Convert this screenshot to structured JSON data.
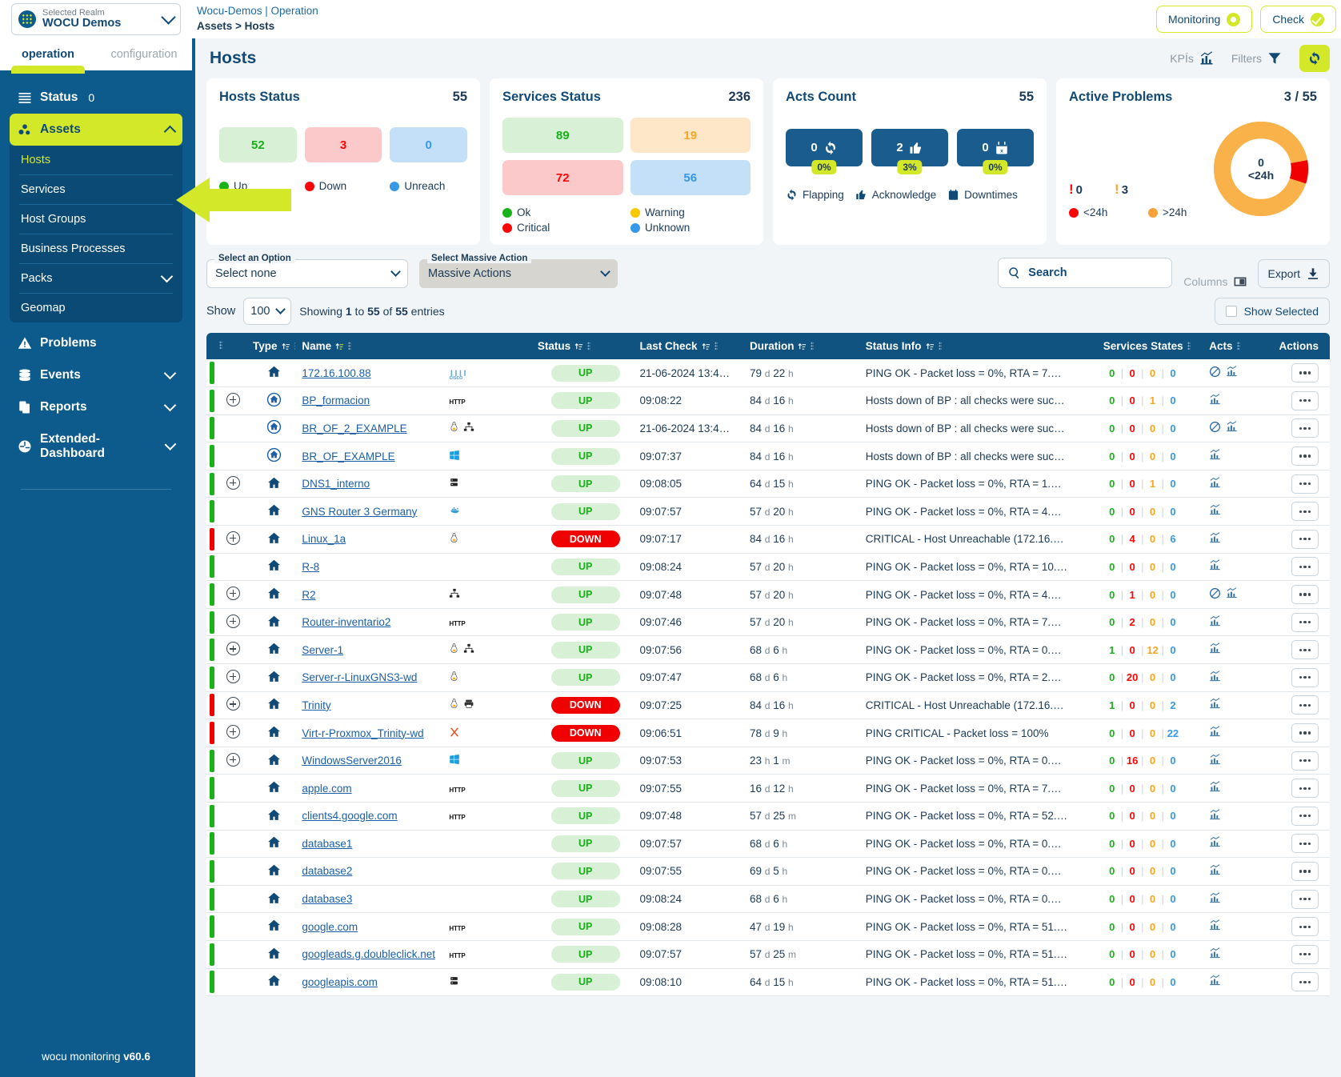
{
  "realm": {
    "label": "Selected Realm",
    "name": "WOCU Demos"
  },
  "breadcrumb": {
    "line1": "Wocu-Demos | Operation",
    "line2": "Assets > Hosts"
  },
  "header_buttons": {
    "monitoring": "Monitoring",
    "check": "Check"
  },
  "tabs": {
    "operation": "operation",
    "configuration": "configuration"
  },
  "sidebar": {
    "status": {
      "label": "Status",
      "count": "0"
    },
    "assets": {
      "label": "Assets"
    },
    "assets_sub": [
      {
        "label": "Hosts",
        "selected": true
      },
      {
        "label": "Services",
        "selected": false
      },
      {
        "label": "Host Groups",
        "selected": false
      },
      {
        "label": "Business Processes",
        "selected": false
      },
      {
        "label": "Packs",
        "selected": false,
        "expandable": true
      },
      {
        "label": "Geomap",
        "selected": false
      }
    ],
    "items": [
      {
        "label": "Problems",
        "expandable": false
      },
      {
        "label": "Events",
        "expandable": true
      },
      {
        "label": "Reports",
        "expandable": true
      },
      {
        "label": "Extended-Dashboard",
        "expandable": true
      }
    ],
    "footer": {
      "text": "wocu monitoring",
      "version": "v60.6"
    }
  },
  "page": {
    "title": "Hosts",
    "kpis_label": "KPÍs",
    "filters_label": "Filters"
  },
  "cards": {
    "hosts_status": {
      "title": "Hosts Status",
      "total": "55",
      "boxes": [
        {
          "value": "52",
          "tone": "green"
        },
        {
          "value": "3",
          "tone": "red"
        },
        {
          "value": "0",
          "tone": "blue"
        }
      ],
      "legend": [
        {
          "label": "Up",
          "tone": "g"
        },
        {
          "label": "Down",
          "tone": "r"
        },
        {
          "label": "Unreach",
          "tone": "b"
        }
      ]
    },
    "services_status": {
      "title": "Services Status",
      "total": "236",
      "boxes": [
        {
          "value": "89",
          "tone": "green"
        },
        {
          "value": "19",
          "tone": "orange"
        },
        {
          "value": "72",
          "tone": "red"
        },
        {
          "value": "56",
          "tone": "blue"
        }
      ],
      "legend": [
        {
          "label": "Ok",
          "tone": "g"
        },
        {
          "label": "Warning",
          "tone": "y"
        },
        {
          "label": "Critical",
          "tone": "r"
        },
        {
          "label": "Unknown",
          "tone": "b"
        }
      ]
    },
    "acts_count": {
      "title": "Acts Count",
      "total": "55",
      "boxes": [
        {
          "value": "0",
          "pct": "0%",
          "icon": "flapping-icon"
        },
        {
          "value": "2",
          "pct": "3%",
          "icon": "thumbs-up-icon"
        },
        {
          "value": "0",
          "pct": "0%",
          "icon": "calendar-icon"
        }
      ],
      "legend": [
        {
          "label": "Flapping",
          "icon": "flapping-icon"
        },
        {
          "label": "Acknowledge",
          "icon": "thumbs-up-icon"
        },
        {
          "label": "Downtimes",
          "icon": "calendar-icon"
        }
      ]
    },
    "active_problems": {
      "title": "Active Problems",
      "total": "3 / 55",
      "counts": [
        {
          "value": "0",
          "tone": "r"
        },
        {
          "value": "3",
          "tone": "o"
        }
      ],
      "legend": [
        {
          "label": "<24h",
          "tone": "r"
        },
        {
          "label": ">24h",
          "tone": "o"
        }
      ],
      "donut": {
        "center_value": "0",
        "center_label": "<24h",
        "red_pct": 8,
        "orange_pct": 92
      }
    }
  },
  "controls": {
    "select_option": {
      "label": "Select an Option",
      "value": "Select none"
    },
    "massive_action": {
      "label": "Select Massive Action",
      "value": "Massive Actions"
    },
    "search_placeholder": "Search",
    "columns_label": "Columns",
    "export_label": "Export",
    "show_label": "Show",
    "show_value": "100",
    "showing_text_pre": "Showing ",
    "showing_from": "1",
    "showing_mid": " to ",
    "showing_to": "55",
    "showing_of": " of ",
    "showing_total": "55",
    "showing_post": " entries",
    "show_selected_label": "Show Selected"
  },
  "table": {
    "columns": [
      "Type",
      "Name",
      "Status",
      "Last Check",
      "Duration",
      "Status Info",
      "Services States",
      "Acts",
      "Actions"
    ],
    "rows": [
      {
        "expand": false,
        "type_icon": "home-icon",
        "name": "172.16.100.88",
        "tech": [
          "cisco"
        ],
        "status": "UP",
        "last_check": "21-06-2024 13:4…",
        "dur_n": "79",
        "dur_u1": "d",
        "dur_n2": "22",
        "dur_u2": "h",
        "info": "PING OK - Packet loss = 0%, RTA = 7.…",
        "svc": [
          "0",
          "0",
          "0",
          "0"
        ],
        "acts": [
          "no-entry-icon",
          "chart-icon"
        ]
      },
      {
        "expand": true,
        "type_icon": "bp-icon",
        "name": "BP_formacion",
        "tech": [
          "http"
        ],
        "status": "UP",
        "last_check": "09:08:22",
        "dur_n": "84",
        "dur_u1": "d",
        "dur_n2": "16",
        "dur_u2": "h",
        "info": "Hosts down of BP : all checks were suc…",
        "svc": [
          "0",
          "0",
          "1",
          "0"
        ],
        "acts": [
          "chart-icon"
        ]
      },
      {
        "expand": false,
        "type_icon": "bp-icon",
        "name": "BR_OF_2_EXAMPLE",
        "tech": [
          "linux",
          "network"
        ],
        "status": "UP",
        "last_check": "21-06-2024 13:4…",
        "dur_n": "84",
        "dur_u1": "d",
        "dur_n2": "16",
        "dur_u2": "h",
        "info": "Hosts down of BP : all checks were suc…",
        "svc": [
          "0",
          "0",
          "0",
          "0"
        ],
        "acts": [
          "no-entry-icon",
          "chart-icon"
        ]
      },
      {
        "expand": false,
        "type_icon": "bp-icon",
        "name": "BR_OF_EXAMPLE",
        "tech": [
          "windows"
        ],
        "status": "UP",
        "last_check": "09:07:37",
        "dur_n": "84",
        "dur_u1": "d",
        "dur_n2": "16",
        "dur_u2": "h",
        "info": "Hosts down of BP : all checks were suc…",
        "svc": [
          "0",
          "0",
          "0",
          "0"
        ],
        "acts": [
          "chart-icon"
        ]
      },
      {
        "expand": true,
        "type_icon": "home-icon",
        "name": "DNS1_interno",
        "tech": [
          "server"
        ],
        "status": "UP",
        "last_check": "09:08:05",
        "dur_n": "64",
        "dur_u1": "d",
        "dur_n2": "15",
        "dur_u2": "h",
        "info": "PING OK - Packet loss = 0%, RTA = 1.…",
        "svc": [
          "0",
          "0",
          "1",
          "0"
        ],
        "acts": [
          "chart-icon"
        ]
      },
      {
        "expand": false,
        "type_icon": "home-icon",
        "name": "GNS Router 3 Germany",
        "tech": [
          "docker"
        ],
        "status": "UP",
        "last_check": "09:07:57",
        "dur_n": "57",
        "dur_u1": "d",
        "dur_n2": "20",
        "dur_u2": "h",
        "info": "PING OK - Packet loss = 0%, RTA = 4.…",
        "svc": [
          "0",
          "0",
          "0",
          "0"
        ],
        "acts": [
          "chart-icon"
        ]
      },
      {
        "expand": true,
        "type_icon": "home-icon",
        "name": "Linux_1a",
        "tech": [
          "linux"
        ],
        "status": "DOWN",
        "last_check": "09:07:17",
        "dur_n": "84",
        "dur_u1": "d",
        "dur_n2": "16",
        "dur_u2": "h",
        "info": "CRITICAL - Host Unreachable (172.16.…",
        "svc": [
          "0",
          "4",
          "0",
          "6"
        ],
        "acts": [
          "chart-icon"
        ]
      },
      {
        "expand": false,
        "type_icon": "home-icon",
        "name": "R-8",
        "tech": [],
        "status": "UP",
        "last_check": "09:08:24",
        "dur_n": "57",
        "dur_u1": "d",
        "dur_n2": "20",
        "dur_u2": "h",
        "info": "PING OK - Packet loss = 0%, RTA = 10.…",
        "svc": [
          "0",
          "0",
          "0",
          "0"
        ],
        "acts": [
          "chart-icon"
        ]
      },
      {
        "expand": true,
        "type_icon": "home-icon",
        "name": "R2",
        "tech": [
          "network"
        ],
        "status": "UP",
        "last_check": "09:07:48",
        "dur_n": "57",
        "dur_u1": "d",
        "dur_n2": "20",
        "dur_u2": "h",
        "info": "PING OK - Packet loss = 0%, RTA = 4.…",
        "svc": [
          "0",
          "1",
          "0",
          "0"
        ],
        "acts": [
          "no-entry-icon",
          "chart-icon"
        ]
      },
      {
        "expand": true,
        "type_icon": "home-icon",
        "name": "Router-inventario2",
        "tech": [
          "http"
        ],
        "status": "UP",
        "last_check": "09:07:46",
        "dur_n": "57",
        "dur_u1": "d",
        "dur_n2": "20",
        "dur_u2": "h",
        "info": "PING OK - Packet loss = 0%, RTA = 7.…",
        "svc": [
          "0",
          "2",
          "0",
          "0"
        ],
        "acts": [
          "chart-icon"
        ]
      },
      {
        "expand": true,
        "type_icon": "home-icon",
        "name": "Server-1",
        "tech": [
          "linux",
          "network"
        ],
        "status": "UP",
        "last_check": "09:07:56",
        "dur_n": "68",
        "dur_u1": "d",
        "dur_n2": "6",
        "dur_u2": "h",
        "info": "PING OK - Packet loss = 0%, RTA = 0.…",
        "svc": [
          "1",
          "0",
          "12",
          "0"
        ],
        "acts": [
          "chart-icon"
        ]
      },
      {
        "expand": true,
        "type_icon": "home-icon",
        "name": "Server-r-LinuxGNS3-wd",
        "tech": [
          "linux"
        ],
        "status": "UP",
        "last_check": "09:07:47",
        "dur_n": "68",
        "dur_u1": "d",
        "dur_n2": "6",
        "dur_u2": "h",
        "info": "PING OK - Packet loss = 0%, RTA = 2.…",
        "svc": [
          "0",
          "20",
          "0",
          "0"
        ],
        "acts": [
          "chart-icon"
        ]
      },
      {
        "expand": true,
        "type_icon": "home-icon",
        "name": "Trinity",
        "tech": [
          "linux",
          "printer"
        ],
        "status": "DOWN",
        "last_check": "09:07:25",
        "dur_n": "84",
        "dur_u1": "d",
        "dur_n2": "16",
        "dur_u2": "h",
        "info": "CRITICAL - Host Unreachable (172.16.…",
        "svc": [
          "1",
          "0",
          "0",
          "2"
        ],
        "acts": [
          "chart-icon"
        ]
      },
      {
        "expand": true,
        "type_icon": "home-icon",
        "name": "Virt-r-Proxmox_Trinity-wd",
        "tech": [
          "proxmox"
        ],
        "status": "DOWN",
        "last_check": "09:06:51",
        "dur_n": "78",
        "dur_u1": "d",
        "dur_n2": "9",
        "dur_u2": "h",
        "info": "PING CRITICAL - Packet loss = 100%",
        "svc": [
          "0",
          "0",
          "0",
          "22"
        ],
        "acts": [
          "chart-icon"
        ]
      },
      {
        "expand": true,
        "type_icon": "home-icon",
        "name": "WindowsServer2016",
        "tech": [
          "windows"
        ],
        "status": "UP",
        "last_check": "09:07:53",
        "dur_n": "23",
        "dur_u1": "h",
        "dur_n2": "1",
        "dur_u2": "m",
        "info": "PING OK - Packet loss = 0%, RTA = 0.…",
        "svc": [
          "0",
          "16",
          "0",
          "0"
        ],
        "acts": [
          "chart-icon"
        ]
      },
      {
        "expand": false,
        "type_icon": "home-icon",
        "name": "apple.com",
        "tech": [
          "http"
        ],
        "status": "UP",
        "last_check": "09:07:55",
        "dur_n": "16",
        "dur_u1": "d",
        "dur_n2": "12",
        "dur_u2": "h",
        "info": "PING OK - Packet loss = 0%, RTA = 7.…",
        "svc": [
          "0",
          "0",
          "0",
          "0"
        ],
        "acts": [
          "chart-icon"
        ]
      },
      {
        "expand": false,
        "type_icon": "home-icon",
        "name": "clients4.google.com",
        "tech": [
          "http"
        ],
        "status": "UP",
        "last_check": "09:07:48",
        "dur_n": "57",
        "dur_u1": "d",
        "dur_n2": "25",
        "dur_u2": "m",
        "info": "PING OK - Packet loss = 0%, RTA = 52.…",
        "svc": [
          "0",
          "0",
          "0",
          "0"
        ],
        "acts": [
          "chart-icon"
        ]
      },
      {
        "expand": false,
        "type_icon": "home-icon",
        "name": "database1",
        "tech": [],
        "status": "UP",
        "last_check": "09:07:57",
        "dur_n": "68",
        "dur_u1": "d",
        "dur_n2": "6",
        "dur_u2": "h",
        "info": "PING OK - Packet loss = 0%, RTA = 0.…",
        "svc": [
          "0",
          "0",
          "0",
          "0"
        ],
        "acts": [
          "chart-icon"
        ]
      },
      {
        "expand": false,
        "type_icon": "home-icon",
        "name": "database2",
        "tech": [],
        "status": "UP",
        "last_check": "09:07:55",
        "dur_n": "69",
        "dur_u1": "d",
        "dur_n2": "5",
        "dur_u2": "h",
        "info": "PING OK - Packet loss = 0%, RTA = 0.…",
        "svc": [
          "0",
          "0",
          "0",
          "0"
        ],
        "acts": [
          "chart-icon"
        ]
      },
      {
        "expand": false,
        "type_icon": "home-icon",
        "name": "database3",
        "tech": [],
        "status": "UP",
        "last_check": "09:08:24",
        "dur_n": "68",
        "dur_u1": "d",
        "dur_n2": "6",
        "dur_u2": "h",
        "info": "PING OK - Packet loss = 0%, RTA = 0.…",
        "svc": [
          "0",
          "0",
          "0",
          "0"
        ],
        "acts": [
          "chart-icon"
        ]
      },
      {
        "expand": false,
        "type_icon": "home-icon",
        "name": "google.com",
        "tech": [
          "http"
        ],
        "status": "UP",
        "last_check": "09:08:28",
        "dur_n": "47",
        "dur_u1": "d",
        "dur_n2": "19",
        "dur_u2": "h",
        "info": "PING OK - Packet loss = 0%, RTA = 51.…",
        "svc": [
          "0",
          "0",
          "0",
          "0"
        ],
        "acts": [
          "chart-icon"
        ]
      },
      {
        "expand": false,
        "type_icon": "home-icon",
        "name": "googleads.g.doubleclick.net",
        "tech": [
          "http"
        ],
        "status": "UP",
        "last_check": "09:07:57",
        "dur_n": "57",
        "dur_u1": "d",
        "dur_n2": "25",
        "dur_u2": "m",
        "info": "PING OK - Packet loss = 0%, RTA = 51.…",
        "svc": [
          "0",
          "0",
          "0",
          "0"
        ],
        "acts": [
          "chart-icon"
        ]
      },
      {
        "expand": false,
        "type_icon": "home-icon",
        "name": "googleapis.com",
        "tech": [
          "server"
        ],
        "status": "UP",
        "last_check": "09:08:10",
        "dur_n": "64",
        "dur_u1": "d",
        "dur_n2": "15",
        "dur_u2": "h",
        "info": "PING OK - Packet loss = 0%, RTA = 51.…",
        "svc": [
          "0",
          "0",
          "0",
          "0"
        ],
        "acts": [
          "chart-icon"
        ]
      }
    ]
  }
}
